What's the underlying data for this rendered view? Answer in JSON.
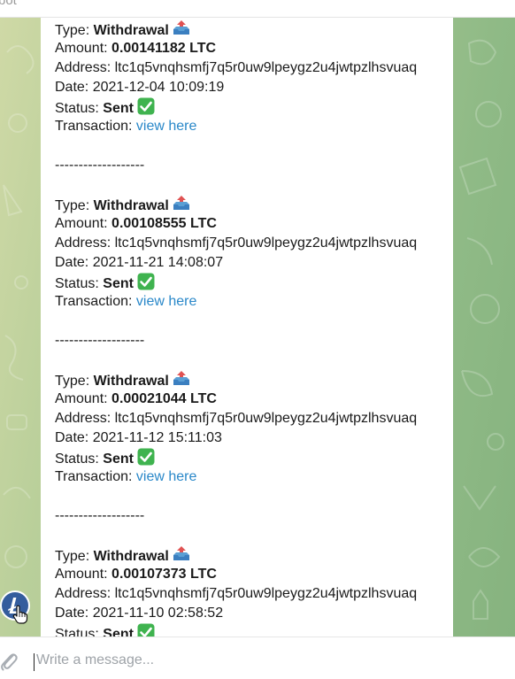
{
  "header": {
    "bot_label": "bot"
  },
  "labels": {
    "type": "Type:",
    "amount": "Amount:",
    "address": "Address:",
    "date": "Date:",
    "status": "Status:",
    "transaction": "Transaction:"
  },
  "separator": "-------------------",
  "transactions": [
    {
      "type": "Withdrawal",
      "amount": "0.00141182 LTC",
      "address": "ltc1q5vnqhsmfj7q5r0uw9lpeygz2u4jwtpzlhsvuaq",
      "date": "2021-12-04 10:09:19",
      "status": "Sent",
      "link": "view here"
    },
    {
      "type": "Withdrawal",
      "amount": "0.00108555 LTC",
      "address": "ltc1q5vnqhsmfj7q5r0uw9lpeygz2u4jwtpzlhsvuaq",
      "date": "2021-11-21 14:08:07",
      "status": "Sent",
      "link": "view here"
    },
    {
      "type": "Withdrawal",
      "amount": "0.00021044 LTC",
      "address": "ltc1q5vnqhsmfj7q5r0uw9lpeygz2u4jwtpzlhsvuaq",
      "date": "2021-11-12 15:11:03",
      "status": "Sent",
      "link": "view here"
    },
    {
      "type": "Withdrawal",
      "amount": "0.00107373 LTC",
      "address": "ltc1q5vnqhsmfj7q5r0uw9lpeygz2u4jwtpzlhsvuaq",
      "date": "2021-11-10 02:58:52",
      "status": "Sent",
      "link": ""
    }
  ],
  "icons": {
    "withdrawal": "outbox-tray-icon",
    "status": "check-mark-button-icon",
    "avatar": "litecoin-logo-icon",
    "attach": "paperclip-icon",
    "cursor": "hand-pointer-icon"
  },
  "colors": {
    "link": "#2a88c9",
    "check": "#3fb34f",
    "avatar": "#345d9d",
    "chat_bg": "#a4c590"
  },
  "composer": {
    "placeholder": "Write a message..."
  }
}
